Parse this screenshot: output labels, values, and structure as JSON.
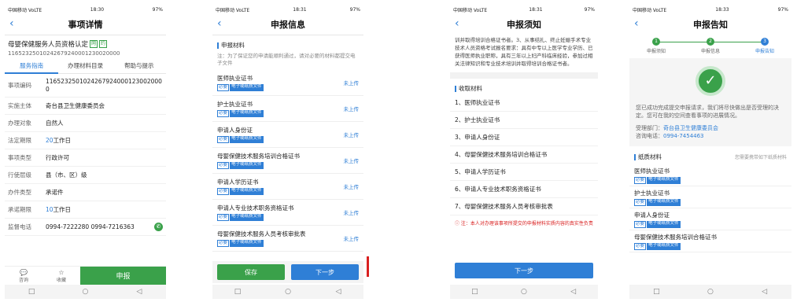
{
  "status": {
    "carrier": "中国移动 VoLTE",
    "battery": "97%",
    "times": [
      "18:30",
      "18:31",
      "18:31",
      "18:33"
    ]
  },
  "screen1": {
    "title": "事项详情",
    "item_title": "母婴保健服务人员资格认定",
    "tags": [
      "网",
      "约"
    ],
    "code_line": "11652325010242679240001230020000",
    "tabs": [
      "服务指南",
      "办理材料目录",
      "帮助与提示"
    ],
    "rows": [
      {
        "k": "事项编码",
        "v": "11652325010242679240001230020000"
      },
      {
        "k": "实施主体",
        "v": "奇台县卫生健康委员会"
      },
      {
        "k": "办理对象",
        "v": "自然人"
      },
      {
        "k": "法定期限",
        "v_num": "20",
        "v_unit": "工作日"
      },
      {
        "k": "事项类型",
        "v": "行政许可"
      },
      {
        "k": "行使层级",
        "v": "县（市、区）级"
      },
      {
        "k": "办件类型",
        "v": "承诺件"
      },
      {
        "k": "承诺期限",
        "v_num": "10",
        "v_unit": "工作日"
      },
      {
        "k": "监督电话",
        "v": "0994-7222280 0994-7216363"
      }
    ],
    "bottom": {
      "consult": "咨询",
      "favorite": "收藏",
      "apply": "申报"
    }
  },
  "screen2": {
    "title": "申报信息",
    "section": "申报材料",
    "note": "注：为了保证您的申请能顺利通过，请对必要的材料都提交电子文件",
    "req_badge": "必要",
    "etype_badge": "电子或纸质文件",
    "upload_label": "未上传",
    "materials": [
      "医师执业证书",
      "护士执业证书",
      "申请人身份证",
      "母婴保健技术服务培训合格证书",
      "申请人学历证书",
      "申请人专业技术职务资格证书",
      "母婴保健技术服务人员考核审批表"
    ],
    "save": "保存",
    "next": "下一步"
  },
  "screen3": {
    "title": "申报须知",
    "text": "训并取得培训合格证书者。3、从事结扎、终止妊娠手术专业技术人员资格考试报名要求：具有中专以上医学专业学历、已获得医师执业职称，具有三年以上妇产科临床经验，参加过相关法律知识和专业技术培训并取得培训合格证书者。",
    "section": "收取材料",
    "items": [
      "1、医师执业证书",
      "2、护士执业证书",
      "3、申请人身份证",
      "4、母婴保健技术服务培训合格证书",
      "5、申请人学历证书",
      "6、申请人专业技术职务资格证书",
      "7、母婴保健技术服务人员考核审批表"
    ],
    "warning": "ⓘ 注：本人对办理该事项所提交的申报材料实质内容的真实性负责",
    "next": "下一步"
  },
  "screen4": {
    "title": "申报告知",
    "steps": [
      "申报须知",
      "申报信息",
      "申报告知"
    ],
    "success_text": "您已成功完成提交申报请求，我们将尽快做出是否受理的决定。您可在我的空间查看事项的进展情况。",
    "dept_label": "受理部门：",
    "dept": "奇台县卫生健康委员会",
    "phone_label": "咨询电话：",
    "phone": "0994-7454463",
    "section": "纸质材料",
    "hint": "您需要携带如下纸质材料",
    "badge": "电子或纸质文件",
    "req_badge": "必要",
    "items": [
      "医师执业证书",
      "护士执业证书",
      "申请人身份证",
      "母婴保健技术服务培训合格证书"
    ]
  }
}
